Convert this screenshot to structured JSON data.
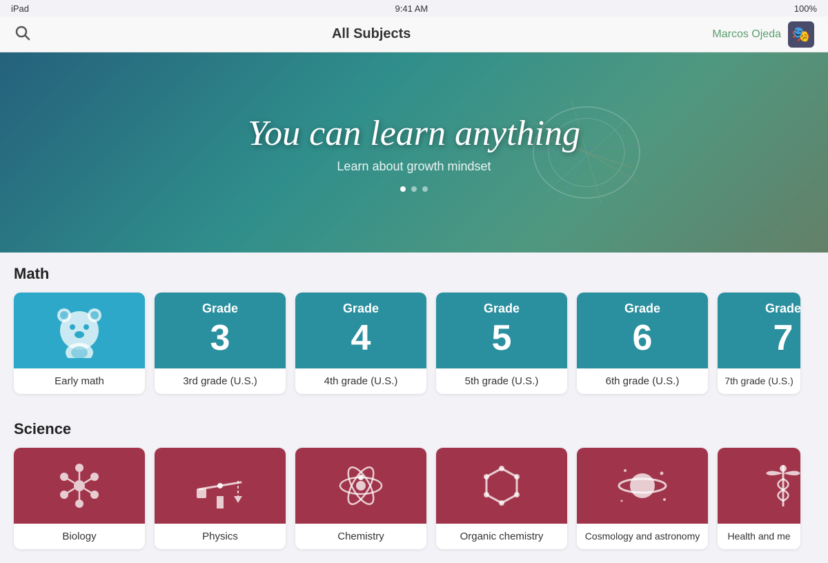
{
  "statusBar": {
    "device": "iPad",
    "time": "9:41 AM",
    "battery": "100%"
  },
  "navBar": {
    "title": "All Subjects",
    "username": "Marcos Ojeda",
    "searchIcon": "🔍",
    "avatarIcon": "🎮"
  },
  "hero": {
    "title": "You can learn anything",
    "subtitle": "Learn about growth mindset",
    "dots": [
      true,
      false,
      false
    ]
  },
  "math": {
    "sectionTitle": "Math",
    "cards": [
      {
        "id": "early-math",
        "label": "Early math",
        "type": "early"
      },
      {
        "id": "grade3",
        "label": "3rd grade (U.S.)",
        "type": "grade",
        "gradeWord": "Grade",
        "gradeNum": "3"
      },
      {
        "id": "grade4",
        "label": "4th grade (U.S.)",
        "type": "grade",
        "gradeWord": "Grade",
        "gradeNum": "4"
      },
      {
        "id": "grade5",
        "label": "5th grade (U.S.)",
        "type": "grade",
        "gradeWord": "Grade",
        "gradeNum": "5"
      },
      {
        "id": "grade6",
        "label": "6th grade (U.S.)",
        "type": "grade",
        "gradeWord": "Grade",
        "gradeNum": "6"
      },
      {
        "id": "grade7",
        "label": "7th grade (U.S.)",
        "type": "grade",
        "gradeWord": "Grade",
        "gradeNum": "7"
      }
    ]
  },
  "science": {
    "sectionTitle": "Science",
    "cards": [
      {
        "id": "biology",
        "label": "Biology",
        "icon": "biology"
      },
      {
        "id": "physics",
        "label": "Physics",
        "icon": "physics"
      },
      {
        "id": "chemistry",
        "label": "Chemistry",
        "icon": "chemistry"
      },
      {
        "id": "organic-chemistry",
        "label": "Organic chemistry",
        "icon": "organic"
      },
      {
        "id": "cosmology",
        "label": "Cosmology and astronomy",
        "icon": "cosmology"
      },
      {
        "id": "health",
        "label": "Health and me",
        "icon": "health"
      }
    ]
  }
}
